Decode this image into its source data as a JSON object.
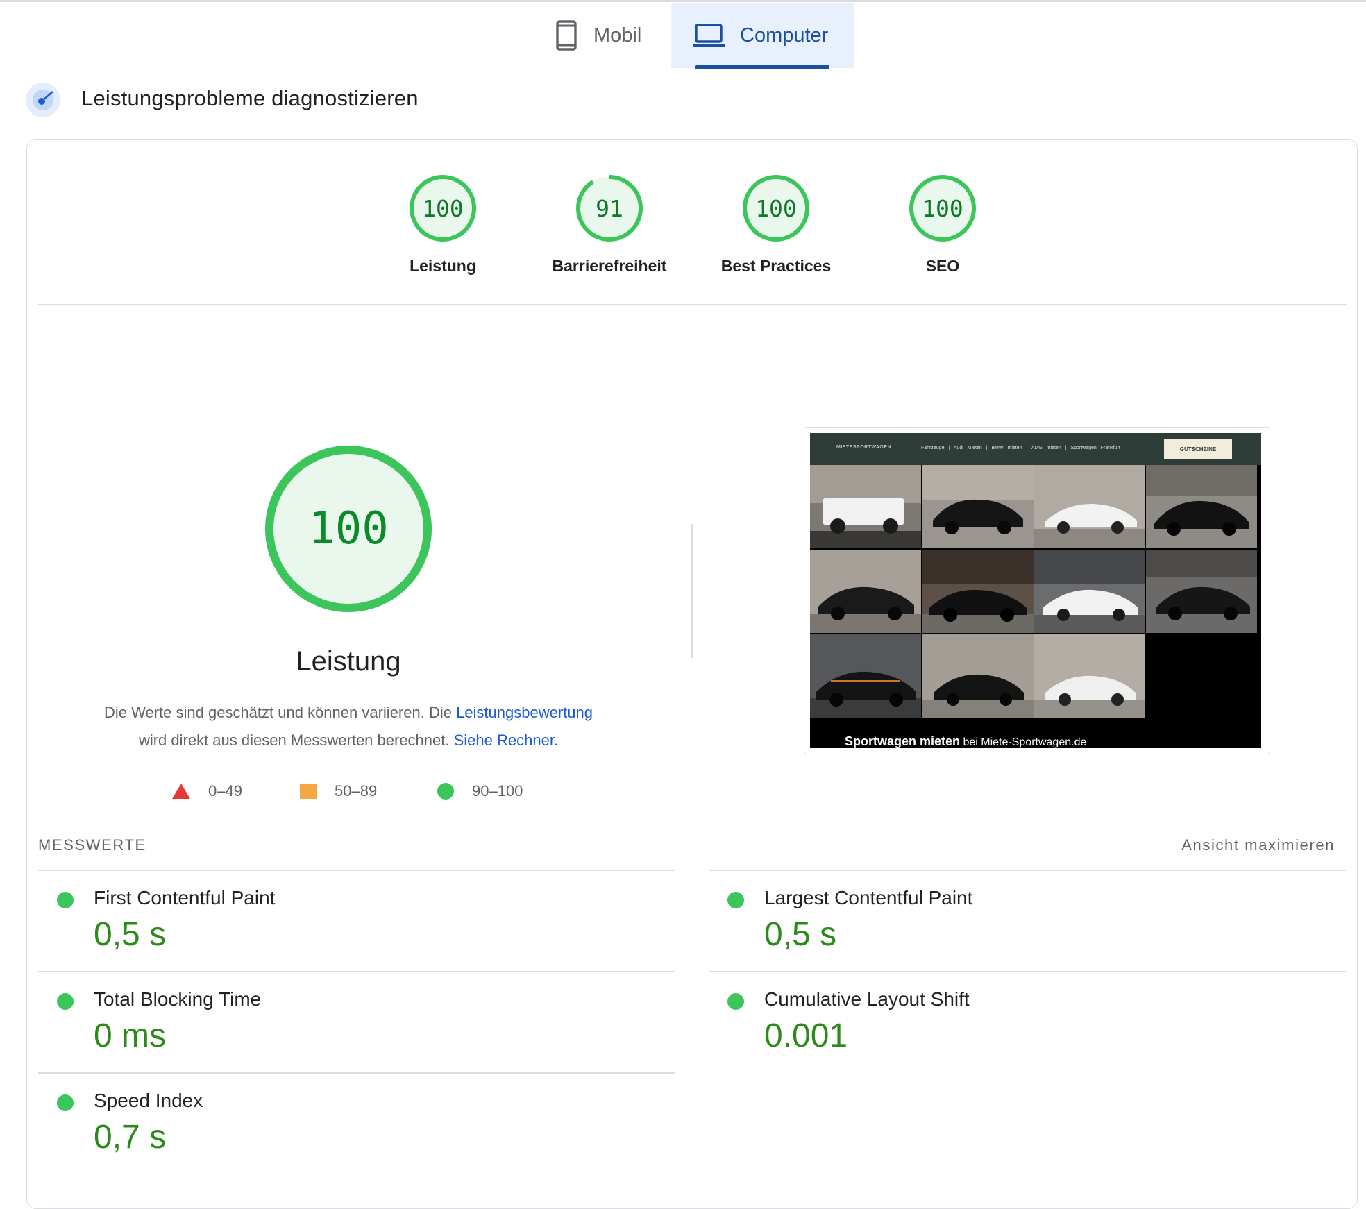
{
  "tabs": {
    "mobile": {
      "label": "Mobil",
      "icon": "smartphone-icon"
    },
    "computer": {
      "label": "Computer",
      "icon": "laptop-icon",
      "selected": true
    }
  },
  "diagnose": {
    "title": "Leistungsprobleme diagnostizieren"
  },
  "scores": [
    {
      "label": "Leistung",
      "value": "100",
      "fraction": 1.0
    },
    {
      "label": "Barrierefreiheit",
      "value": "91",
      "fraction": 0.91
    },
    {
      "label": "Best Practices",
      "value": "100",
      "fraction": 1.0
    },
    {
      "label": "SEO",
      "value": "100",
      "fraction": 1.0
    }
  ],
  "performance": {
    "score": "100",
    "title": "Leistung",
    "desc_part1": "Die Werte sind geschätzt und können variieren. Die ",
    "desc_link1": "Leistungsbewertung",
    "desc_part2": "wird direkt aus diesen Messwerten berechnet. ",
    "desc_link2": "Siehe Rechner.",
    "legend": [
      {
        "range": "0–49",
        "icon": "triangle-icon",
        "color": "#e53935"
      },
      {
        "range": "50–89",
        "icon": "square-icon",
        "color": "#f4a743"
      },
      {
        "range": "90–100",
        "icon": "circle-icon",
        "color": "#3bc55b"
      }
    ]
  },
  "screenshot": {
    "nav_logo": "MIETESPORTWAGEN",
    "nav_menu": "Fahrzeuge | Audi Mieten | BMW mieten | AMG mieten | Sportwagen Frankfurt",
    "nav_button": "GUTSCHEINE",
    "caption_bold": "Sportwagen mieten",
    "caption_rest": " bei Miete-Sportwagen.de"
  },
  "metrics": {
    "heading": "MESSWERTE",
    "expand_label": "Ansicht maximieren",
    "items": [
      {
        "label": "First Contentful Paint",
        "value": "0,5 s"
      },
      {
        "label": "Largest Contentful Paint",
        "value": "0,5 s"
      },
      {
        "label": "Total Blocking Time",
        "value": "0 ms"
      },
      {
        "label": "Cumulative Layout Shift",
        "value": "0.001"
      },
      {
        "label": "Speed Index",
        "value": "0,7 s"
      }
    ]
  },
  "colors": {
    "pass_green": "#3bc55b",
    "pass_text": "#0b7a27",
    "link_blue": "#1a5bd6",
    "tab_active_bg": "#e8f0fe"
  }
}
